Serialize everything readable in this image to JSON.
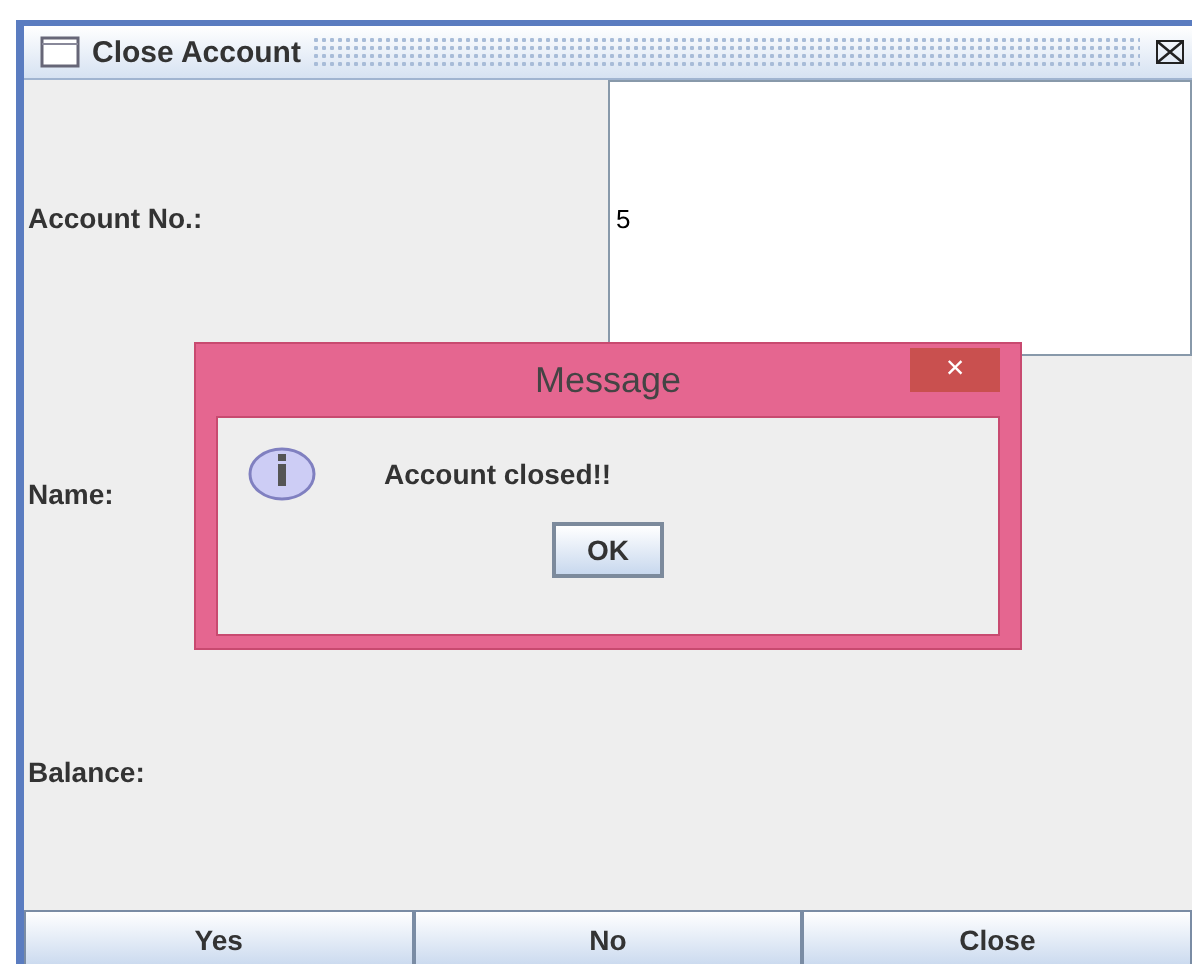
{
  "window": {
    "title": "Close Account"
  },
  "form": [
    {
      "label": "Account No.:",
      "value": "5"
    },
    {
      "label": "Name:"
    },
    {
      "label": "Balance:"
    }
  ],
  "buttons": [
    "Yes",
    "No",
    "Close"
  ],
  "dialog": {
    "title": "Message",
    "close": "×",
    "message": "Account closed!!",
    "button": "OK"
  }
}
